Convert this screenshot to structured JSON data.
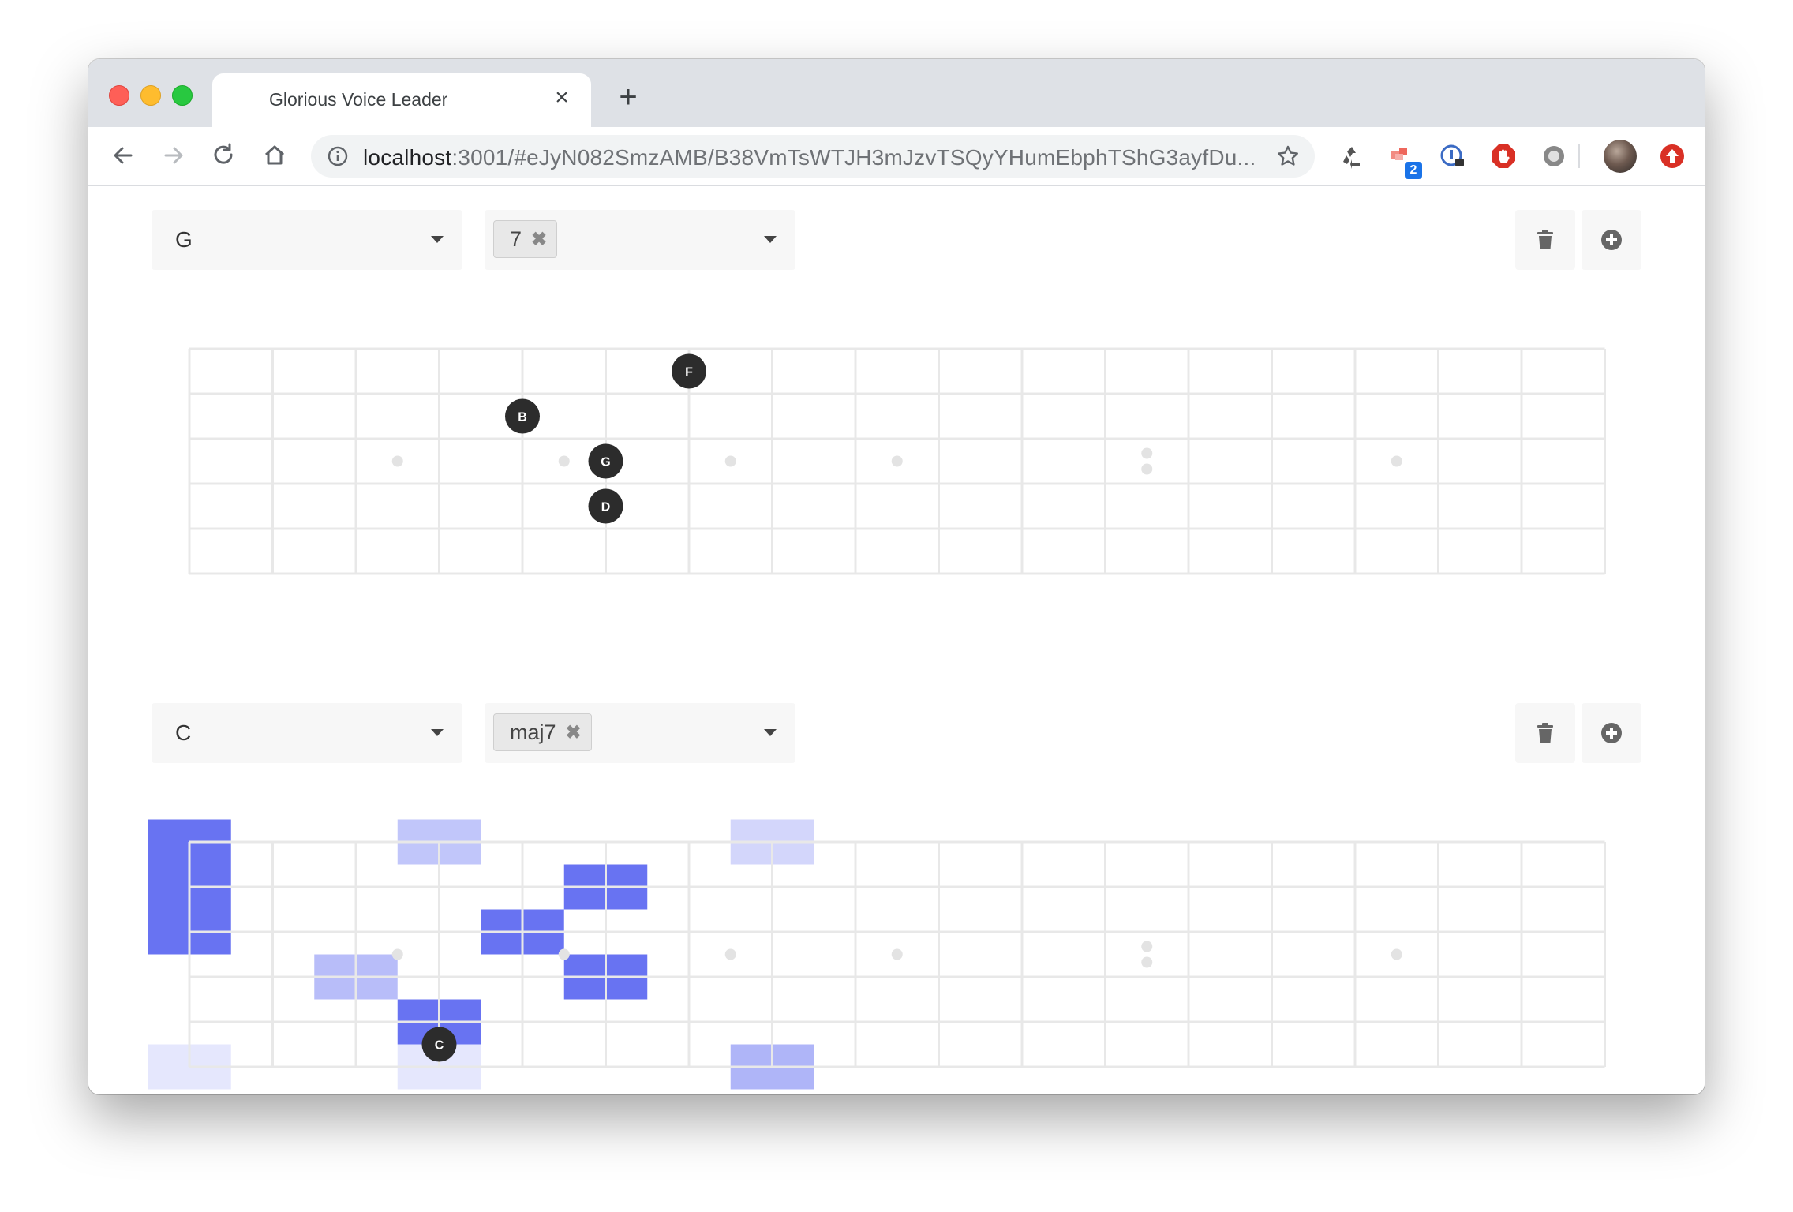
{
  "browser": {
    "tab_title": "Glorious Voice Leader",
    "tab_close": "×",
    "new_tab": "+",
    "url_host": "localhost",
    "url_rest": ":3001/#eJyN082SmzAMB/B38VmTsWTJH3mJzvTSQyYHumEbphTShG3ayfDu...",
    "extension_badge": "2"
  },
  "chords": [
    {
      "root": "G",
      "quality": "7",
      "chip_remove": "✖",
      "notes": [
        {
          "label": "F",
          "string": 1,
          "fret": 6
        },
        {
          "label": "B",
          "string": 2,
          "fret": 4
        },
        {
          "label": "G",
          "string": 3,
          "fret": 5
        },
        {
          "label": "D",
          "string": 4,
          "fret": 5
        }
      ],
      "highlights": []
    },
    {
      "root": "C",
      "quality": "maj7",
      "chip_remove": "✖",
      "notes": [
        {
          "label": "C",
          "string": 5,
          "fret": 3
        }
      ],
      "highlights": [
        {
          "string": 0,
          "fret": 0,
          "level": 0.85
        },
        {
          "string": 1,
          "fret": 0,
          "level": 0.85
        },
        {
          "string": 2,
          "fret": 0,
          "level": 0.85
        },
        {
          "string": 0,
          "fret": 3,
          "level": 0.35
        },
        {
          "string": 0,
          "fret": 7,
          "level": 0.25
        },
        {
          "string": 1,
          "fret": 5,
          "level": 0.85
        },
        {
          "string": 2,
          "fret": 4,
          "level": 0.85
        },
        {
          "string": 3,
          "fret": 5,
          "level": 0.85
        },
        {
          "string": 3,
          "fret": 2,
          "level": 0.4
        },
        {
          "string": 4,
          "fret": 3,
          "level": 0.85
        },
        {
          "string": 5,
          "fret": 0,
          "level": 0.15
        },
        {
          "string": 5,
          "fret": 3,
          "level": 0.15
        },
        {
          "string": 5,
          "fret": 7,
          "level": 0.45
        }
      ]
    }
  ],
  "fretboard": {
    "frets": 18,
    "strings": 6,
    "inlays_single": [
      3,
      5,
      7,
      9,
      15
    ],
    "inlays_double": [
      12
    ]
  },
  "colors": {
    "note_dot": "#2c2c2c",
    "highlight": "#4e5bf0",
    "grid": "#e8e8e8",
    "inlay": "#e3e3e3"
  }
}
